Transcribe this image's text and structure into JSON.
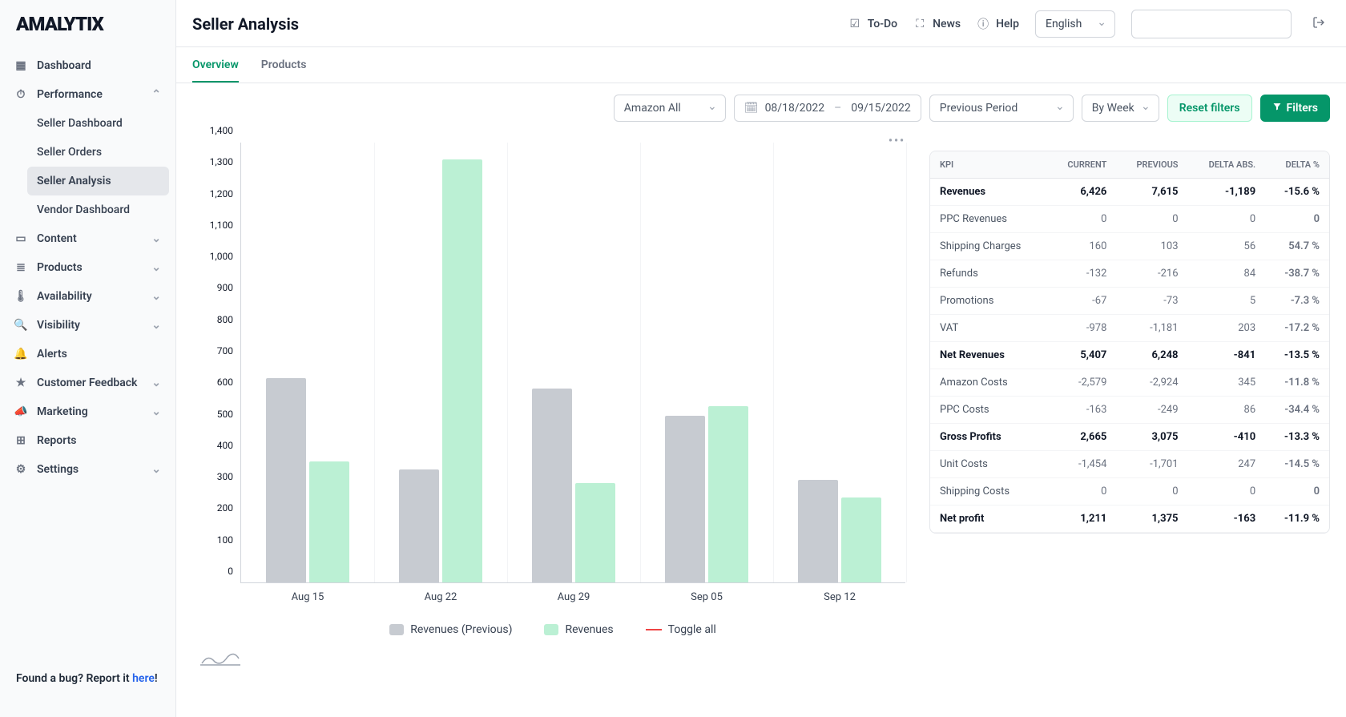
{
  "brand": "AMALYTIX",
  "sidebar": {
    "items": [
      {
        "id": "dashboard",
        "label": "Dashboard",
        "icon": "grid"
      },
      {
        "id": "performance",
        "label": "Performance",
        "icon": "gauge",
        "expanded": true,
        "sub": [
          {
            "id": "seller-dashboard",
            "label": "Seller Dashboard"
          },
          {
            "id": "seller-orders",
            "label": "Seller Orders"
          },
          {
            "id": "seller-analysis",
            "label": "Seller Analysis",
            "active": true
          },
          {
            "id": "vendor-dashboard",
            "label": "Vendor Dashboard"
          }
        ]
      },
      {
        "id": "content",
        "label": "Content",
        "icon": "card",
        "expandable": true
      },
      {
        "id": "products",
        "label": "Products",
        "icon": "list",
        "expandable": true
      },
      {
        "id": "availability",
        "label": "Availability",
        "icon": "thermo",
        "expandable": true
      },
      {
        "id": "visibility",
        "label": "Visibility",
        "icon": "search",
        "expandable": true
      },
      {
        "id": "alerts",
        "label": "Alerts",
        "icon": "bell"
      },
      {
        "id": "customer-feedback",
        "label": "Customer Feedback",
        "icon": "star",
        "expandable": true
      },
      {
        "id": "marketing",
        "label": "Marketing",
        "icon": "megaphone",
        "expandable": true
      },
      {
        "id": "reports",
        "label": "Reports",
        "icon": "table"
      },
      {
        "id": "settings",
        "label": "Settings",
        "icon": "gear",
        "expandable": true
      }
    ],
    "bug_prefix": "Found a bug? Report it ",
    "bug_link": "here",
    "bug_suffix": "!"
  },
  "header": {
    "title": "Seller Analysis",
    "todo": "To-Do",
    "news": "News",
    "help": "Help",
    "language": "English"
  },
  "tabs": {
    "overview": "Overview",
    "products": "Products"
  },
  "filters": {
    "marketplace": "Amazon All",
    "date_from": "08/18/2022",
    "date_to": "09/15/2022",
    "compare": "Previous Period",
    "granularity": "By Week",
    "reset": "Reset filters",
    "filters_btn": "Filters"
  },
  "chart_data": {
    "type": "bar",
    "ylim": [
      0,
      1400
    ],
    "yticks": [
      0,
      100,
      200,
      300,
      400,
      500,
      600,
      700,
      800,
      900,
      1000,
      1100,
      1200,
      1300,
      1400
    ],
    "categories": [
      "Aug 15",
      "Aug 22",
      "Aug 29",
      "Sep 05",
      "Sep 12"
    ],
    "series": [
      {
        "name": "Revenues (Previous)",
        "values": [
          650,
          360,
          615,
          530,
          325
        ]
      },
      {
        "name": "Revenues",
        "values": [
          385,
          1345,
          315,
          560,
          270
        ]
      }
    ],
    "toggle_label": "Toggle all"
  },
  "kpi": {
    "headers": {
      "kpi": "KPI",
      "current": "CURRENT",
      "previous": "PREVIOUS",
      "delta_abs": "DELTA ABS.",
      "delta_pct": "DELTA %"
    },
    "rows": [
      {
        "name": "Revenues",
        "current": "6,426",
        "previous": "7,615",
        "delta_abs": "-1,189",
        "delta_pct": "-15.6 %",
        "bold": true,
        "sign": "neg"
      },
      {
        "name": "PPC Revenues",
        "current": "0",
        "previous": "0",
        "delta_abs": "0",
        "delta_pct": "0",
        "sign": "pos"
      },
      {
        "name": "Shipping Charges",
        "current": "160",
        "previous": "103",
        "delta_abs": "56",
        "delta_pct": "54.7 %",
        "sign": "pos"
      },
      {
        "name": "Refunds",
        "current": "-132",
        "previous": "-216",
        "delta_abs": "84",
        "delta_pct": "-38.7 %",
        "sign": "pos"
      },
      {
        "name": "Promotions",
        "current": "-67",
        "previous": "-73",
        "delta_abs": "5",
        "delta_pct": "-7.3 %",
        "sign": "pos"
      },
      {
        "name": "VAT",
        "current": "-978",
        "previous": "-1,181",
        "delta_abs": "203",
        "delta_pct": "-17.2 %",
        "sign": "pos"
      },
      {
        "name": "Net Revenues",
        "current": "5,407",
        "previous": "6,248",
        "delta_abs": "-841",
        "delta_pct": "-13.5 %",
        "bold": true,
        "sign": "neg"
      },
      {
        "name": "Amazon Costs",
        "current": "-2,579",
        "previous": "-2,924",
        "delta_abs": "345",
        "delta_pct": "-11.8 %",
        "sign": "pos"
      },
      {
        "name": "PPC Costs",
        "current": "-163",
        "previous": "-249",
        "delta_abs": "86",
        "delta_pct": "-34.4 %",
        "sign": "pos"
      },
      {
        "name": "Gross Profits",
        "current": "2,665",
        "previous": "3,075",
        "delta_abs": "-410",
        "delta_pct": "-13.3 %",
        "bold": true,
        "sign": "neg"
      },
      {
        "name": "Unit Costs",
        "current": "-1,454",
        "previous": "-1,701",
        "delta_abs": "247",
        "delta_pct": "-14.5 %",
        "sign": "pos"
      },
      {
        "name": "Shipping Costs",
        "current": "0",
        "previous": "0",
        "delta_abs": "0",
        "delta_pct": "0",
        "sign": "pos"
      },
      {
        "name": "Net profit",
        "current": "1,211",
        "previous": "1,375",
        "delta_abs": "-163",
        "delta_pct": "-11.9 %",
        "bold": true,
        "sign": "neg"
      }
    ]
  }
}
